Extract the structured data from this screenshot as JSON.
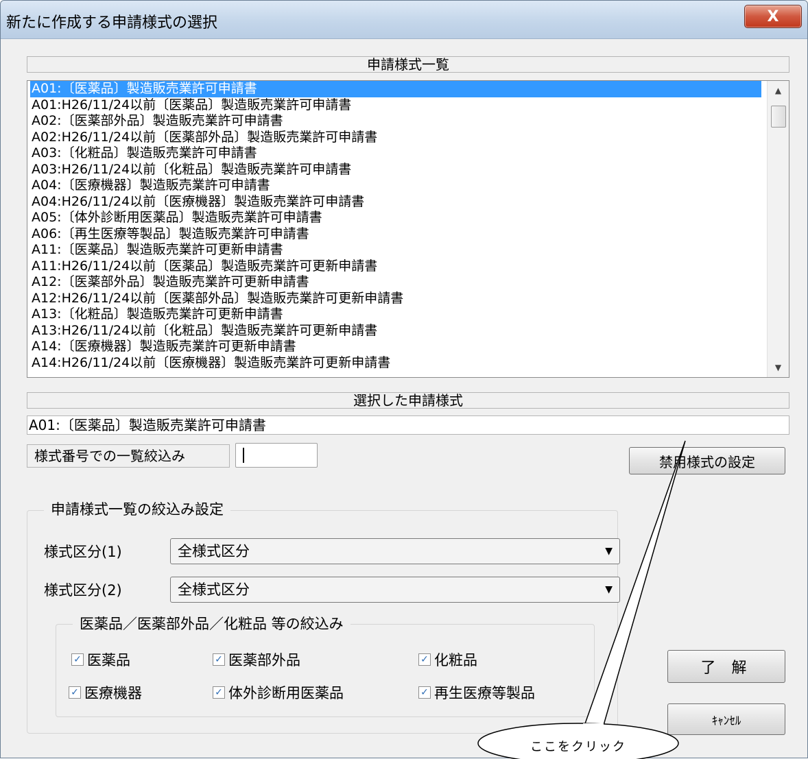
{
  "window": {
    "title": "新たに作成する申請様式の選択",
    "close_label": "X"
  },
  "list": {
    "header": "申請様式一覧",
    "items": [
      "A01:〔医薬品〕製造販売業許可申請書",
      "A01:H26/11/24以前〔医薬品〕製造販売業許可申請書",
      "A02:〔医薬部外品〕製造販売業許可申請書",
      "A02:H26/11/24以前〔医薬部外品〕製造販売業許可申請書",
      "A03:〔化粧品〕製造販売業許可申請書",
      "A03:H26/11/24以前〔化粧品〕製造販売業許可申請書",
      "A04:〔医療機器〕製造販売業許可申請書",
      "A04:H26/11/24以前〔医療機器〕製造販売業許可申請書",
      "A05:〔体外診断用医薬品〕製造販売業許可申請書",
      "A06:〔再生医療等製品〕製造販売業許可申請書",
      "A11:〔医薬品〕製造販売業許可更新申請書",
      "A11:H26/11/24以前〔医薬品〕製造販売業許可更新申請書",
      "A12:〔医薬部外品〕製造販売業許可更新申請書",
      "A12:H26/11/24以前〔医薬部外品〕製造販売業許可更新申請書",
      "A13:〔化粧品〕製造販売業許可更新申請書",
      "A13:H26/11/24以前〔化粧品〕製造販売業許可更新申請書",
      "A14:〔医療機器〕製造販売業許可更新申請書",
      "A14:H26/11/24以前〔医療機器〕製造販売業許可更新申請書"
    ],
    "selected_index": 0
  },
  "selected": {
    "header": "選択した申請様式",
    "value": "A01:〔医薬品〕製造販売業許可申請書"
  },
  "filter": {
    "label": "様式番号での一覧絞込み",
    "value": ""
  },
  "buttons": {
    "forbidden_settings": "禁用様式の設定",
    "ok": "了 解",
    "cancel": "ｷｬﾝｾﾙ"
  },
  "narrow_group": {
    "title": "申請様式一覧の絞込み設定",
    "category1_label": "様式区分(1)",
    "category1_value": "全様式区分",
    "category2_label": "様式区分(2)",
    "category2_value": "全様式区分"
  },
  "product_group": {
    "title": "医薬品／医薬部外品／化粧品 等の絞込み",
    "checkboxes": [
      {
        "label": "医薬品",
        "checked": true
      },
      {
        "label": "医薬部外品",
        "checked": true
      },
      {
        "label": "化粧品",
        "checked": true
      },
      {
        "label": "医療機器",
        "checked": true
      },
      {
        "label": "体外診断用医薬品",
        "checked": true
      },
      {
        "label": "再生医療等製品",
        "checked": true
      }
    ]
  },
  "callout": {
    "text": "ここをクリック"
  }
}
